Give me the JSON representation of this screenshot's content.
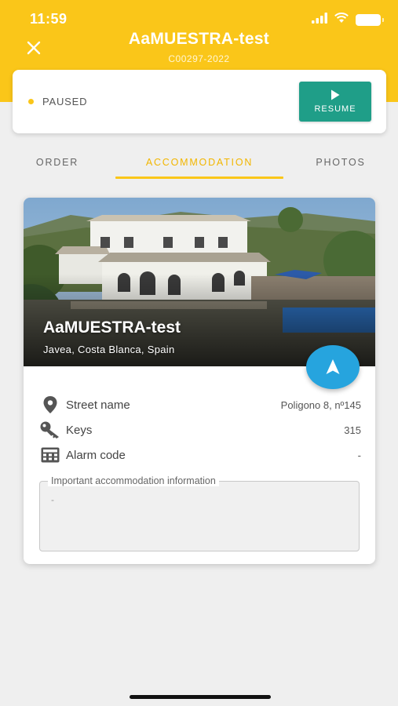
{
  "status_bar": {
    "time": "11:59"
  },
  "header": {
    "title": "AaMUESTRA-test",
    "subtitle": "C00297-2022",
    "bg_color": "#fac619"
  },
  "status_card": {
    "status": "PAUSED",
    "resume_label": "RESUME",
    "resume_color": "#1f9e88"
  },
  "tabs": [
    {
      "label": "ORDER",
      "active": false
    },
    {
      "label": "ACCOMMODATION",
      "active": true
    },
    {
      "label": "PHOTOS",
      "active": false
    }
  ],
  "accommodation": {
    "name": "AaMUESTRA-test",
    "location": "Javea, Costa Blanca, Spain",
    "rows": [
      {
        "icon": "map-pin-icon",
        "label": "Street name",
        "value": "Poligono 8, nº145"
      },
      {
        "icon": "key-icon",
        "label": "Keys",
        "value": "315"
      },
      {
        "icon": "keypad-icon",
        "label": "Alarm code",
        "value": "-"
      }
    ],
    "important_info": {
      "label": "Important accommodation information",
      "value": "-"
    }
  },
  "colors": {
    "accent": "#fac619",
    "fab": "#26a4de"
  }
}
